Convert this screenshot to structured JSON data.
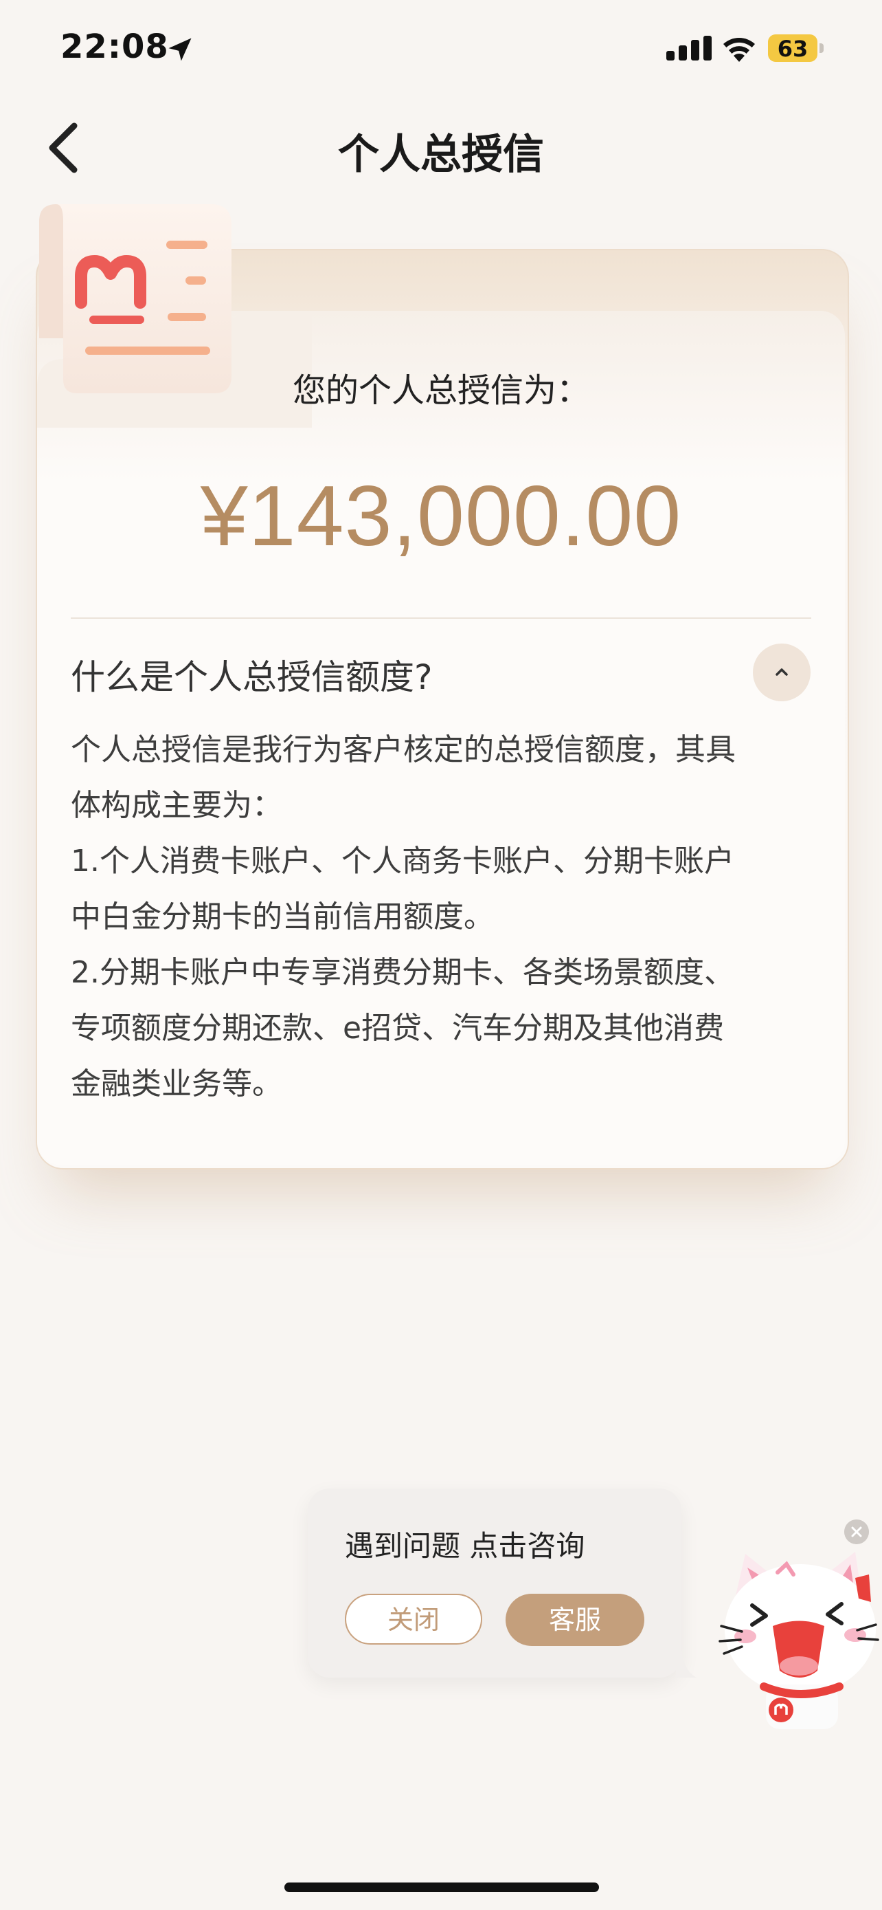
{
  "status_bar": {
    "time": "22:08",
    "battery": "63"
  },
  "header": {
    "title": "个人总授信"
  },
  "card": {
    "label": "您的个人总授信为：",
    "amount": "¥143,000.00"
  },
  "faq": {
    "question": "什么是个人总授信额度?",
    "expanded": true,
    "lines": [
      "个人总授信是我行为客户核定的总授信额度，其具",
      "体构成主要为：",
      "1.个人消费卡账户、个人商务卡账户、分期卡账户",
      "中白金分期卡的当前信用额度。",
      "2.分期卡账户中专享消费分期卡、各类场景额度、",
      "专项额度分期还款、e招贷、汽车分期及其他消费",
      "金融类业务等。"
    ]
  },
  "consult_popup": {
    "text": "遇到问题 点击咨询",
    "close_label": "关闭",
    "service_label": "客服"
  },
  "colors": {
    "accent": "#b58c62",
    "button": "#c49f7c",
    "background": "#f8f5f2"
  },
  "icons": {
    "back": "chevron-left-icon",
    "collapse": "chevron-up-icon",
    "location": "location-arrow-icon",
    "logo": "bank-logo-icon",
    "mascot": "cat-mascot-icon"
  }
}
